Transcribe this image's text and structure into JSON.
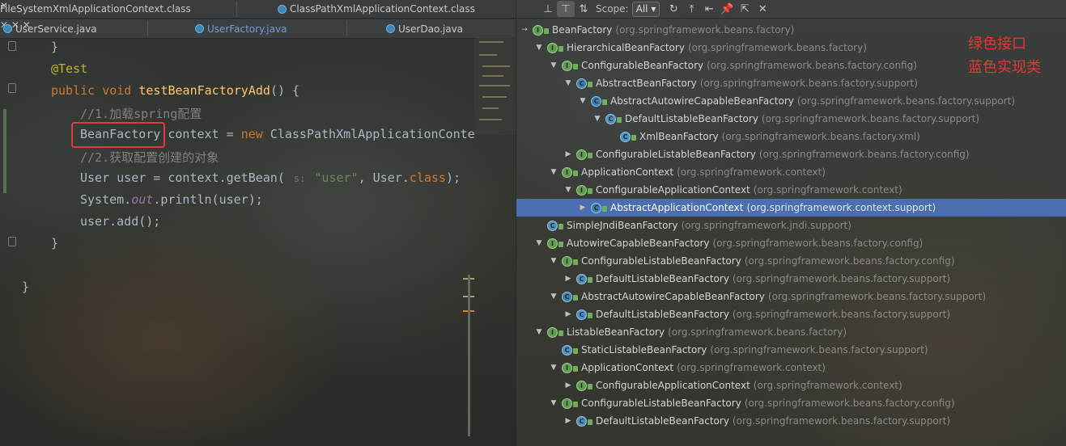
{
  "editor": {
    "tabs_row1": [
      {
        "label": "FileSystemXmlApplicationContext.class"
      },
      {
        "label": "ClassPathXmlApplicationContext.class"
      }
    ],
    "tabs_row2": [
      {
        "label": "UserService.java"
      },
      {
        "label": "UserFactory.java",
        "active": true
      },
      {
        "label": "UserDao.java"
      }
    ],
    "code": {
      "l1": "}",
      "l2": "@Test",
      "l3_kw1": "public",
      "l3_kw2": "void",
      "l3_fn": "testBeanFactoryAdd",
      "l3_rest": "() {",
      "l4": "//1.加载spring配置",
      "l5_type": "BeanFactory",
      "l5_a": " context = ",
      "l5_new": "new",
      "l5_b": " ClassPathXmlApplicationConte",
      "l6": "//2.获取配置创建的对象",
      "l7_a": "User user = context.getBean(",
      "l7_hint": "s:",
      "l7_str": "\"user\"",
      "l7_b": ", User.",
      "l7_kw": "class",
      "l7_c": ");",
      "l8_a": "System.",
      "l8_out": "out",
      "l8_b": ".println(user);",
      "l9": "user.add();",
      "l10": "}",
      "l11": "}"
    }
  },
  "toolbar": {
    "scope_label": "Scope:",
    "scope_value": "All",
    "scope_arrow": "▾"
  },
  "legend": {
    "line1": "绿色接口",
    "line2": "蓝色实现类"
  },
  "tree": [
    {
      "name": "BeanFactory",
      "pkg": "(org.springframework.beans.factory)",
      "kind": "interface",
      "arrow": "→",
      "level": 0
    },
    {
      "name": "HierarchicalBeanFactory",
      "pkg": "(org.springframework.beans.factory)",
      "kind": "interface",
      "arrow": "▼",
      "level": 1
    },
    {
      "name": "ConfigurableBeanFactory",
      "pkg": "(org.springframework.beans.factory.config)",
      "kind": "interface",
      "arrow": "▼",
      "level": 2
    },
    {
      "name": "AbstractBeanFactory",
      "pkg": "(org.springframework.beans.factory.support)",
      "kind": "abstract",
      "arrow": "▼",
      "level": 3
    },
    {
      "name": "AbstractAutowireCapableBeanFactory",
      "pkg": "(org.springframework.beans.factory.support)",
      "kind": "abstract",
      "arrow": "▼",
      "level": 4
    },
    {
      "name": "DefaultListableBeanFactory",
      "pkg": "(org.springframework.beans.factory.support)",
      "kind": "class",
      "arrow": "▼",
      "level": 5
    },
    {
      "name": "XmlBeanFactory",
      "pkg": "(org.springframework.beans.factory.xml)",
      "kind": "class",
      "arrow": "",
      "level": 6
    },
    {
      "name": "ConfigurableListableBeanFactory",
      "pkg": "(org.springframework.beans.factory.config)",
      "kind": "interface",
      "arrow": "▶",
      "level": 3
    },
    {
      "name": "ApplicationContext",
      "pkg": "(org.springframework.context)",
      "kind": "interface",
      "arrow": "▼",
      "level": 2
    },
    {
      "name": "ConfigurableApplicationContext",
      "pkg": "(org.springframework.context)",
      "kind": "interface",
      "arrow": "▼",
      "level": 3
    },
    {
      "name": "AbstractApplicationContext",
      "pkg": "(org.springframework.context.support)",
      "kind": "abstract",
      "arrow": "▶",
      "level": 4,
      "selected": true
    },
    {
      "name": "SimpleJndiBeanFactory",
      "pkg": "(org.springframework.jndi.support)",
      "kind": "class",
      "arrow": "",
      "level": 1
    },
    {
      "name": "AutowireCapableBeanFactory",
      "pkg": "(org.springframework.beans.factory.config)",
      "kind": "interface",
      "arrow": "▼",
      "level": 1
    },
    {
      "name": "ConfigurableListableBeanFactory",
      "pkg": "(org.springframework.beans.factory.config)",
      "kind": "interface",
      "arrow": "▼",
      "level": 2
    },
    {
      "name": "DefaultListableBeanFactory",
      "pkg": "(org.springframework.beans.factory.support)",
      "kind": "class",
      "arrow": "▶",
      "level": 3
    },
    {
      "name": "AbstractAutowireCapableBeanFactory",
      "pkg": "(org.springframework.beans.factory.support)",
      "kind": "abstract",
      "arrow": "▼",
      "level": 2
    },
    {
      "name": "DefaultListableBeanFactory",
      "pkg": "(org.springframework.beans.factory.support)",
      "kind": "class",
      "arrow": "▶",
      "level": 3
    },
    {
      "name": "ListableBeanFactory",
      "pkg": "(org.springframework.beans.factory)",
      "kind": "interface",
      "arrow": "▼",
      "level": 1
    },
    {
      "name": "StaticListableBeanFactory",
      "pkg": "(org.springframework.beans.factory.support)",
      "kind": "class",
      "arrow": "",
      "level": 2
    },
    {
      "name": "ApplicationContext",
      "pkg": "(org.springframework.context)",
      "kind": "interface",
      "arrow": "▼",
      "level": 2
    },
    {
      "name": "ConfigurableApplicationContext",
      "pkg": "(org.springframework.context)",
      "kind": "interface",
      "arrow": "▶",
      "level": 3
    },
    {
      "name": "ConfigurableListableBeanFactory",
      "pkg": "(org.springframework.beans.factory.config)",
      "kind": "interface",
      "arrow": "▼",
      "level": 2
    },
    {
      "name": "DefaultListableBeanFactory",
      "pkg": "(org.springframework.beans.factory.support)",
      "kind": "class",
      "arrow": "▶",
      "level": 3
    }
  ]
}
